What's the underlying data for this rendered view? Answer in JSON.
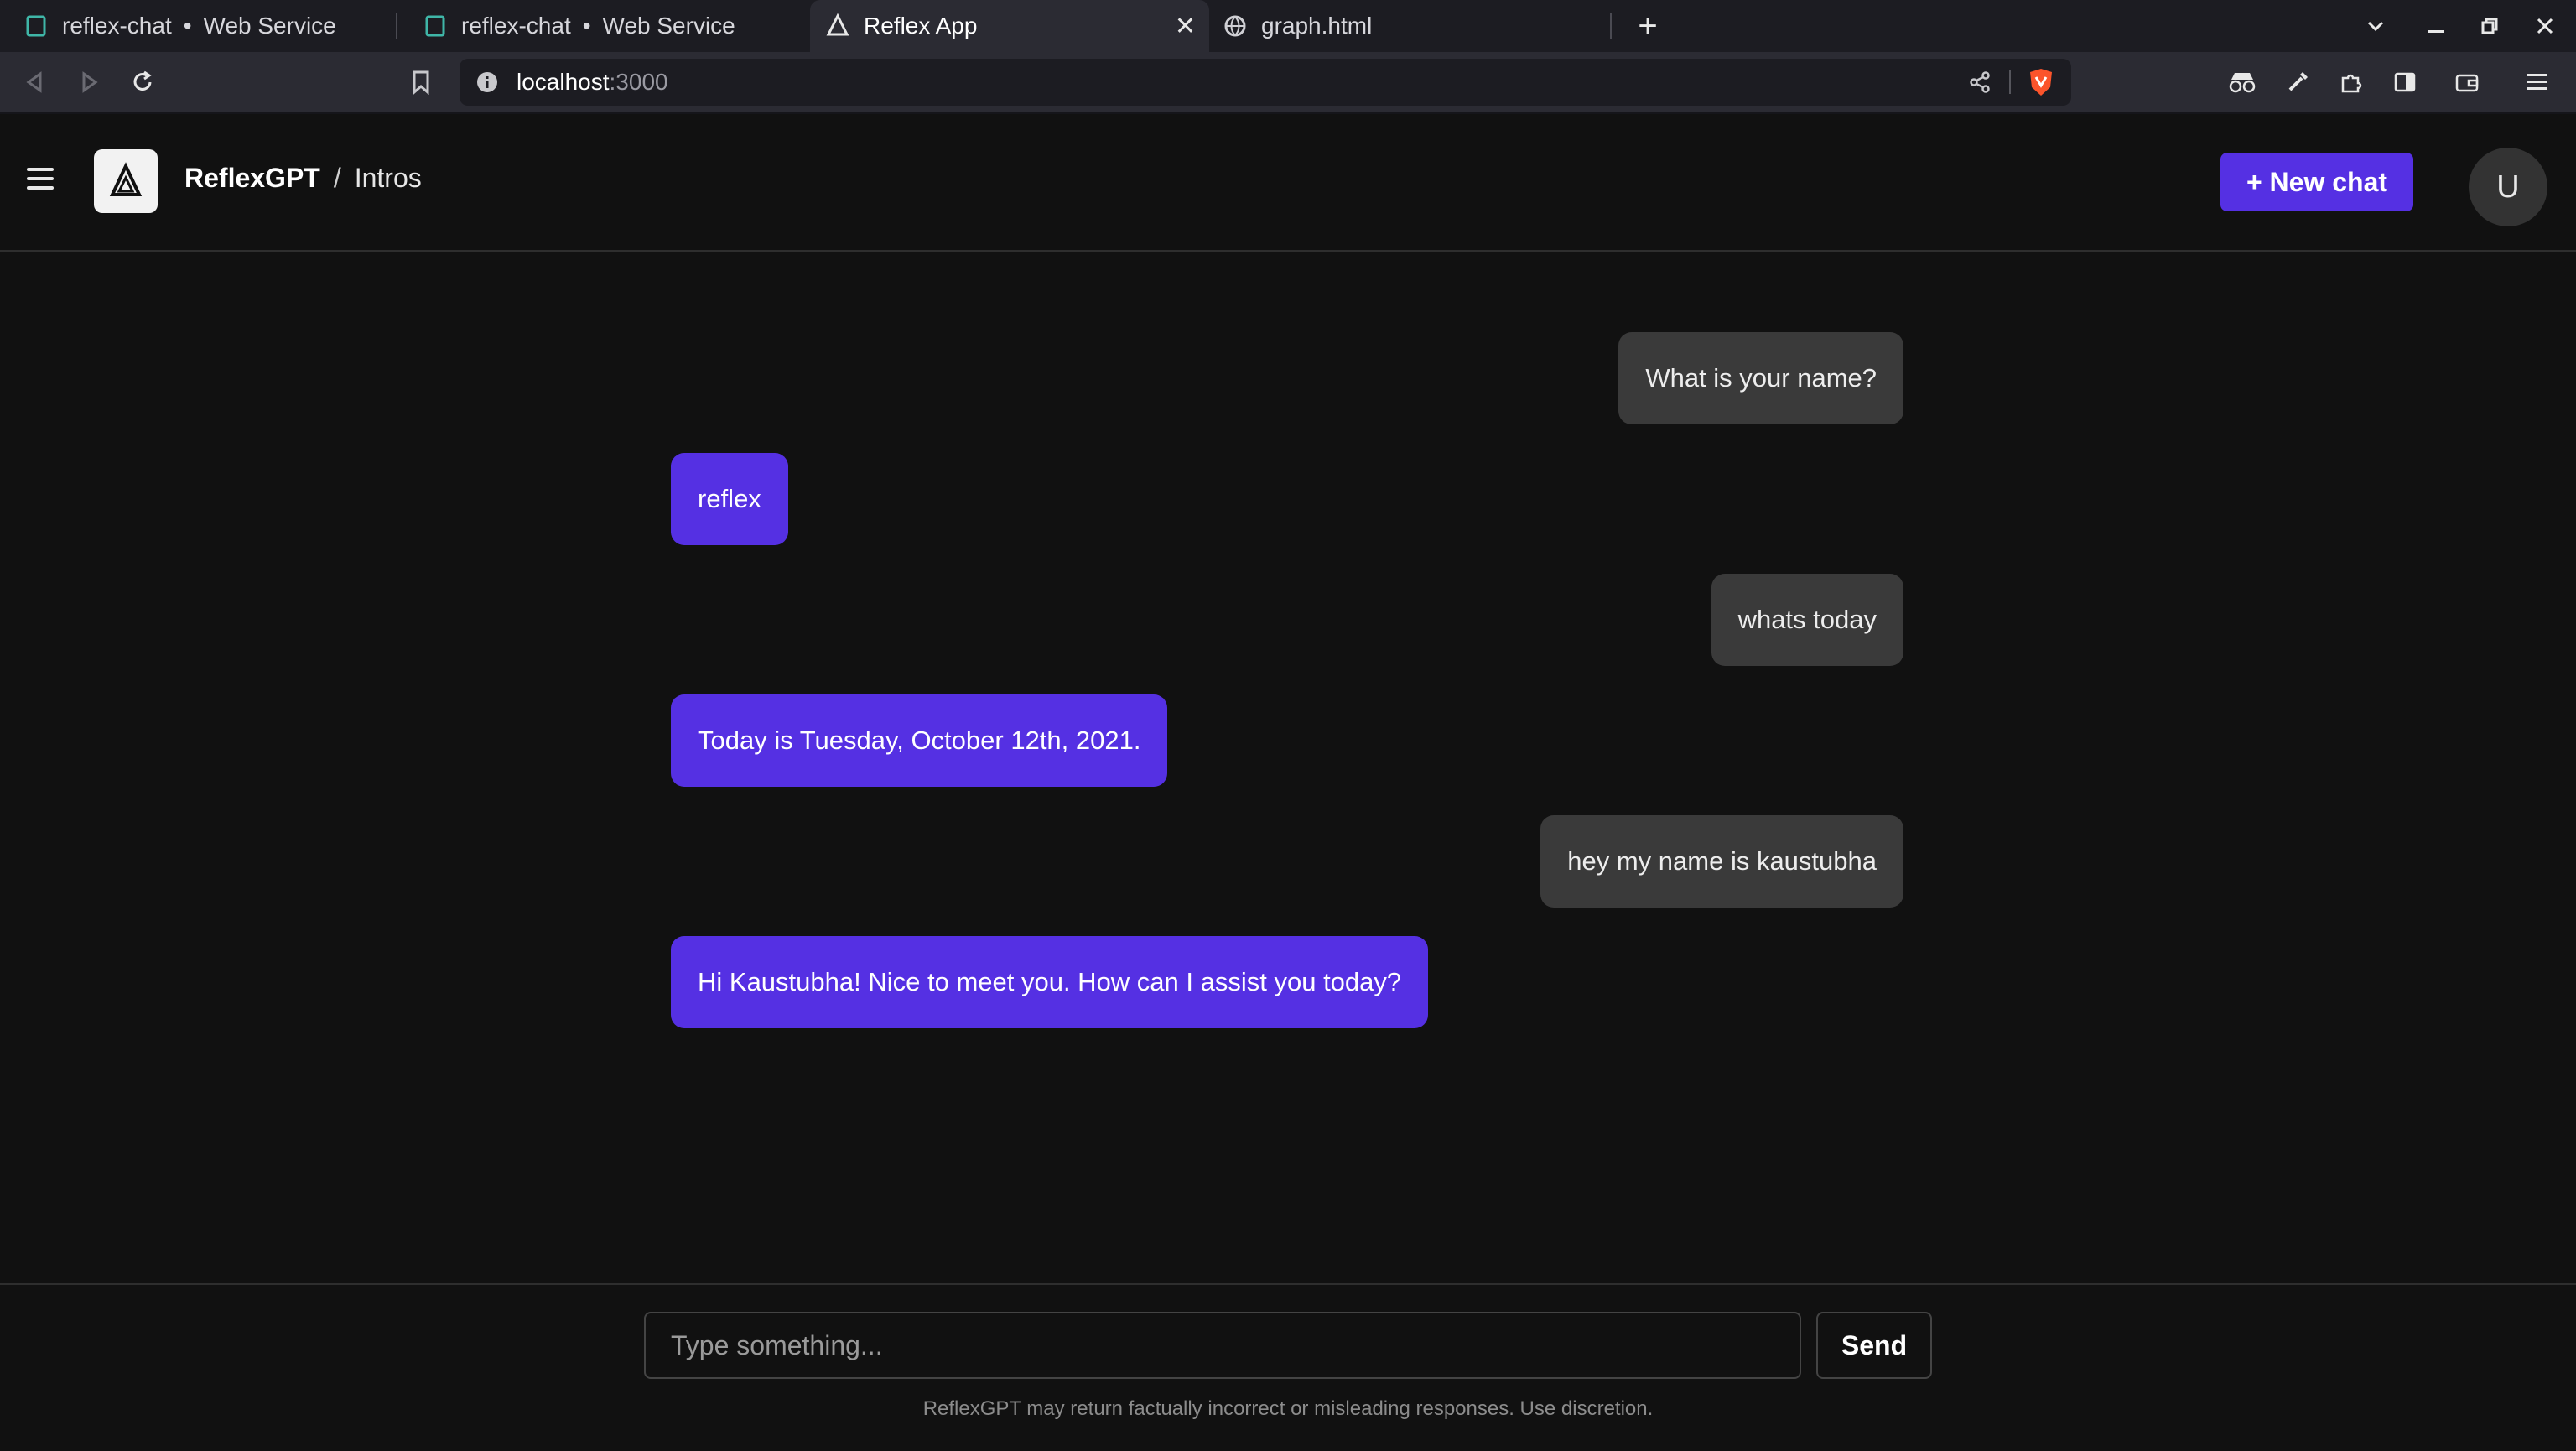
{
  "browser": {
    "tabs": [
      {
        "title": "reflex-chat",
        "suffix": "Web Service",
        "icon": "page-icon"
      },
      {
        "title": "reflex-chat",
        "suffix": "Web Service",
        "icon": "page-icon"
      },
      {
        "title": "Reflex App",
        "icon": "reflex-logo-icon",
        "active": true
      },
      {
        "title": "graph.html",
        "icon": "globe-icon"
      }
    ],
    "url_host": "localhost",
    "url_port": ":3000"
  },
  "header": {
    "brand": "ReflexGPT",
    "separator": "/",
    "chat_name": "Intros",
    "new_chat_label": "+ New chat",
    "avatar_initial": "U"
  },
  "messages": [
    {
      "role": "user",
      "text": "What is your name?"
    },
    {
      "role": "bot",
      "text": "reflex"
    },
    {
      "role": "user",
      "text": "whats today"
    },
    {
      "role": "bot",
      "text": "Today is Tuesday, October 12th, 2021."
    },
    {
      "role": "user",
      "text": "hey my name is kaustubha"
    },
    {
      "role": "bot",
      "text": "Hi Kaustubha! Nice to meet you. How can I assist you today?"
    }
  ],
  "composer": {
    "placeholder": "Type something...",
    "send_label": "Send",
    "disclaimer": "ReflexGPT may return factually incorrect or misleading responses. Use discretion."
  },
  "colors": {
    "accent": "#5530e3",
    "user_bubble": "#3a3a3a",
    "background": "#111111"
  }
}
